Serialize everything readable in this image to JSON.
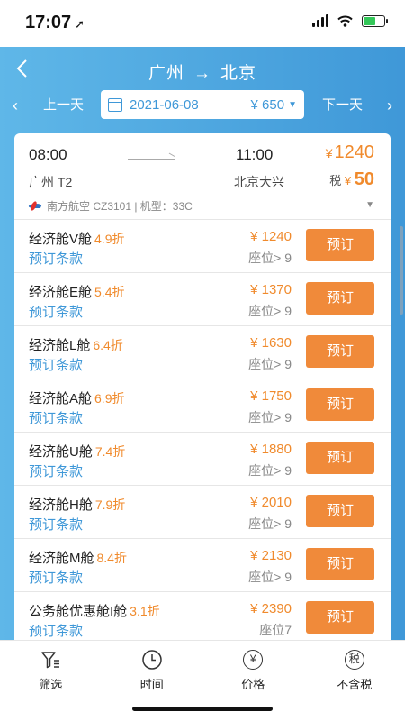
{
  "status": {
    "time": "17:07"
  },
  "header": {
    "from": "广州",
    "arrow": "→",
    "to": "北京",
    "prev_day": "上一天",
    "next_day": "下一天",
    "date": "2021-06-08",
    "date_price": "¥ 650"
  },
  "flight": {
    "dep_time": "08:00",
    "arr_time": "11:00",
    "dep_airport": "广州 T2",
    "arr_airport": "北京大兴",
    "price_symbol": "¥",
    "price": "1240",
    "tax_label": "税",
    "tax_symbol": "¥",
    "tax": "50",
    "airline_info": "南方航空 CZ3101 | 机型：33C"
  },
  "fares": [
    {
      "cabin": "经济舱V舱",
      "discount": "4.9折",
      "terms": "预订条款",
      "price": "¥ 1240",
      "seats": "座位> 9",
      "book": "预订"
    },
    {
      "cabin": "经济舱E舱",
      "discount": "5.4折",
      "terms": "预订条款",
      "price": "¥ 1370",
      "seats": "座位> 9",
      "book": "预订"
    },
    {
      "cabin": "经济舱L舱",
      "discount": "6.4折",
      "terms": "预订条款",
      "price": "¥ 1630",
      "seats": "座位> 9",
      "book": "预订"
    },
    {
      "cabin": "经济舱A舱",
      "discount": "6.9折",
      "terms": "预订条款",
      "price": "¥ 1750",
      "seats": "座位> 9",
      "book": "预订"
    },
    {
      "cabin": "经济舱U舱",
      "discount": "7.4折",
      "terms": "预订条款",
      "price": "¥ 1880",
      "seats": "座位> 9",
      "book": "预订"
    },
    {
      "cabin": "经济舱H舱",
      "discount": "7.9折",
      "terms": "预订条款",
      "price": "¥ 2010",
      "seats": "座位> 9",
      "book": "预订"
    },
    {
      "cabin": "经济舱M舱",
      "discount": "8.4折",
      "terms": "预订条款",
      "price": "¥ 2130",
      "seats": "座位> 9",
      "book": "预订"
    },
    {
      "cabin": "公务舱优惠舱I舱",
      "discount": "3.1折",
      "terms": "预订条款",
      "price": "¥ 2390",
      "seats": "座位7",
      "book": "预订"
    }
  ],
  "tabs": [
    {
      "label": "筛选",
      "icon": "filter-icon"
    },
    {
      "label": "时间",
      "icon": "clock-icon"
    },
    {
      "label": "价格",
      "icon": "yen-icon",
      "glyph": "¥"
    },
    {
      "label": "不含税",
      "icon": "tax-icon",
      "glyph": "税"
    }
  ],
  "colors": {
    "accent": "#3f98d8",
    "price": "#f08a2c",
    "button": "#f08a3a"
  }
}
